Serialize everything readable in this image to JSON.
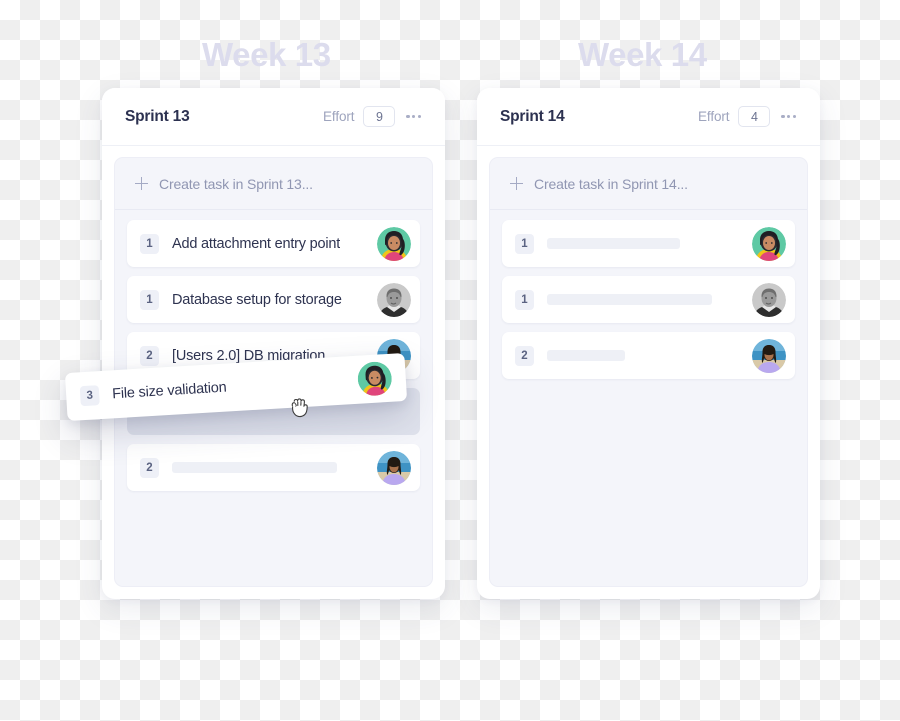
{
  "board": {
    "columns": [
      {
        "week_label": "Week 13",
        "sprint_title": "Sprint 13",
        "effort_label": "Effort",
        "effort_value": "9",
        "menu_icon": "more-options-icon",
        "create_task_label": "Create task in Sprint 13...",
        "tasks": [
          {
            "effort": "1",
            "title": "Add attachment entry point",
            "avatar": "woman-green-bg",
            "skeleton": false
          },
          {
            "effort": "1",
            "title": "Database setup for storage",
            "avatar": "man-grayscale",
            "skeleton": false
          },
          {
            "effort": "2",
            "title": "[Users 2.0] DB migration",
            "avatar": "woman-beach-bg",
            "skeleton": false
          },
          {
            "effort": "2",
            "title": "",
            "avatar": "woman-beach-bg",
            "skeleton": true,
            "skeleton_width": 165
          }
        ]
      },
      {
        "week_label": "Week 14",
        "sprint_title": "Sprint 14",
        "effort_label": "Effort",
        "effort_value": "4",
        "menu_icon": "more-options-icon",
        "create_task_label": "Create task in Sprint 14...",
        "tasks": [
          {
            "effort": "1",
            "title": "",
            "avatar": "woman-green-bg",
            "skeleton": true,
            "skeleton_width": 133
          },
          {
            "effort": "1",
            "title": "",
            "avatar": "man-grayscale",
            "skeleton": true,
            "skeleton_width": 165
          },
          {
            "effort": "2",
            "title": "",
            "avatar": "woman-beach-bg",
            "skeleton": true,
            "skeleton_width": 78
          }
        ]
      }
    ]
  },
  "drag": {
    "effort": "3",
    "title": "File size validation",
    "avatar": "woman-green-bg",
    "cursor_icon": "grabbing-hand-cursor"
  },
  "colors": {
    "card_surface": "#ffffff",
    "list_surface": "#f4f5fa",
    "week_title": "#dcdced",
    "title_text": "#2c3150",
    "muted_text": "#9ea4bd",
    "effort_chip_bg": "#eef0f7",
    "drop_placeholder": "#dfe2ec"
  }
}
